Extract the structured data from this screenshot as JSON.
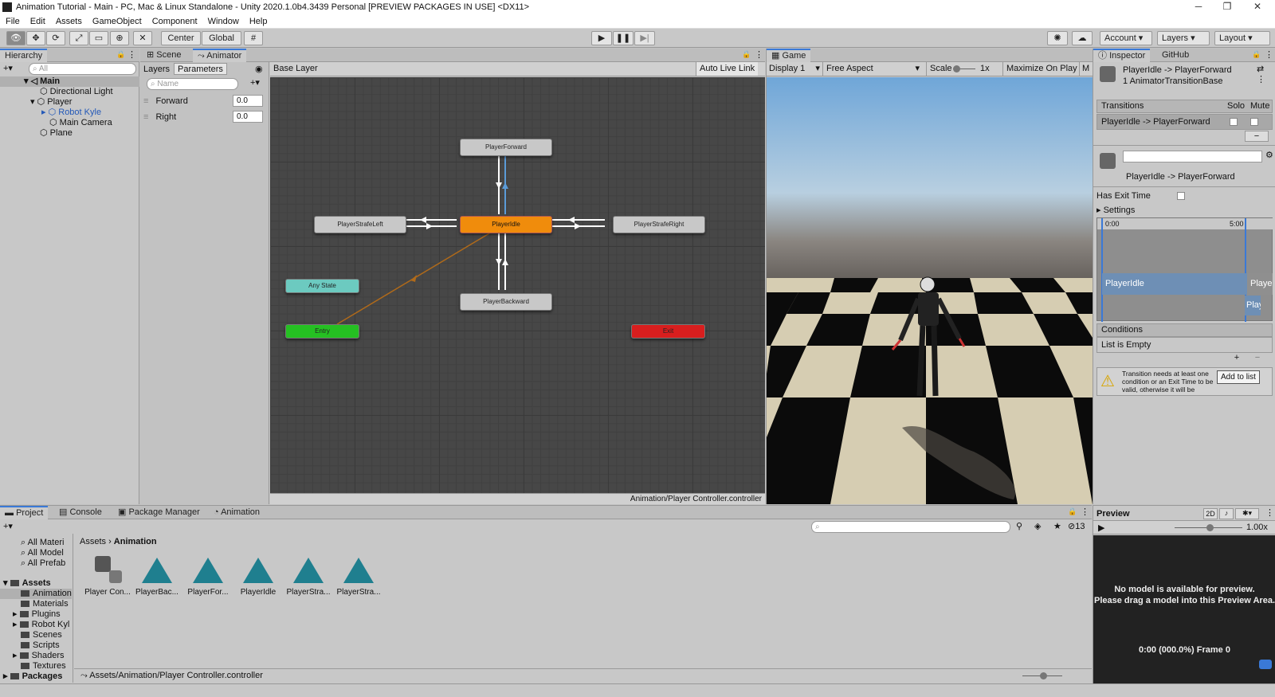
{
  "window": {
    "title": "Animation Tutorial - Main - PC, Mac & Linux Standalone - Unity 2020.1.0b4.3439 Personal [PREVIEW PACKAGES IN USE] <DX11>",
    "controls": {
      "min": "─",
      "max": "❐",
      "close": "✕"
    }
  },
  "menu": [
    "File",
    "Edit",
    "Assets",
    "GameObject",
    "Component",
    "Window",
    "Help"
  ],
  "toolbar": {
    "pivot_center": "Center",
    "pivot_global": "Global",
    "account": "Account",
    "layers": "Layers",
    "layout": "Layout"
  },
  "hierarchy": {
    "tab": "Hierarchy",
    "search_placeholder": "All",
    "scene": "Main",
    "items": [
      "Directional Light",
      "Player",
      "Robot Kyle",
      "Main Camera",
      "Plane"
    ]
  },
  "animator": {
    "tab_scene": "Scene",
    "tab_animator": "Animator",
    "tab_layers": "Layers",
    "tab_parameters": "Parameters",
    "name_placeholder": "Name",
    "params": [
      {
        "name": "Forward",
        "value": "0.0"
      },
      {
        "name": "Right",
        "value": "0.0"
      }
    ],
    "breadcrumb": "Base Layer",
    "auto_live_link": "Auto Live Link",
    "nodes": {
      "forward": "PlayerForward",
      "left": "PlayerStrafeLeft",
      "idle": "PlayerIdle",
      "right": "PlayerStrafeRight",
      "backward": "PlayerBackward",
      "any": "Any State",
      "entry": "Entry",
      "exit": "Exit"
    },
    "footer_path": "Animation/Player Controller.controller"
  },
  "game": {
    "tab": "Game",
    "display": "Display 1",
    "aspect": "Free Aspect",
    "scale_label": "Scale",
    "scale_value": "1x",
    "maximize": "Maximize On Play",
    "m": "M"
  },
  "inspector": {
    "tab": "Inspector",
    "tab2": "GitHub",
    "title": "PlayerIdle -> PlayerForward",
    "subtitle": "1 AnimatorTransitionBase",
    "transitions_header": "Transitions",
    "solo": "Solo",
    "mute": "Mute",
    "transition_item": "PlayerIdle -> PlayerForward",
    "minus": "−",
    "transition_name": "PlayerIdle -> PlayerForward",
    "has_exit_time": "Has Exit Time",
    "settings": "Settings",
    "timeline_start": "0:00",
    "timeline_end": "5:00",
    "clip_a": "PlayerIdle",
    "clip_b": "Playe",
    "clip_c": "Play",
    "conditions": "Conditions",
    "list_empty": "List is Empty",
    "plus": "+",
    "warning": "Transition needs at least one condition or an Exit Time to be valid, otherwise it will be ignored.",
    "tooltip": "Add to list"
  },
  "preview": {
    "label": "Preview",
    "mode": "2D",
    "speed": "1.00x",
    "message_line1": "No model is available for preview.",
    "message_line2": "Please drag a model into this Preview Area.",
    "status": "0:00 (000.0%) Frame 0"
  },
  "project": {
    "tabs": [
      "Project",
      "Console",
      "Package Manager",
      "Animation"
    ],
    "hidden_count": "13",
    "favorites": [
      "All Materi",
      "All Model",
      "All Prefab"
    ],
    "tree_root": "Assets",
    "tree": [
      "Animation",
      "Materials",
      "Plugins",
      "Robot Kyl",
      "Scenes",
      "Scripts",
      "Shaders",
      "Textures"
    ],
    "packages": "Packages",
    "breadcrumb_root": "Assets",
    "breadcrumb_current": "Animation",
    "assets": [
      "Player Con...",
      "PlayerBac...",
      "PlayerFor...",
      "PlayerIdle",
      "PlayerStra...",
      "PlayerStra..."
    ],
    "footer_path": "Assets/Animation/Player Controller.controller"
  }
}
